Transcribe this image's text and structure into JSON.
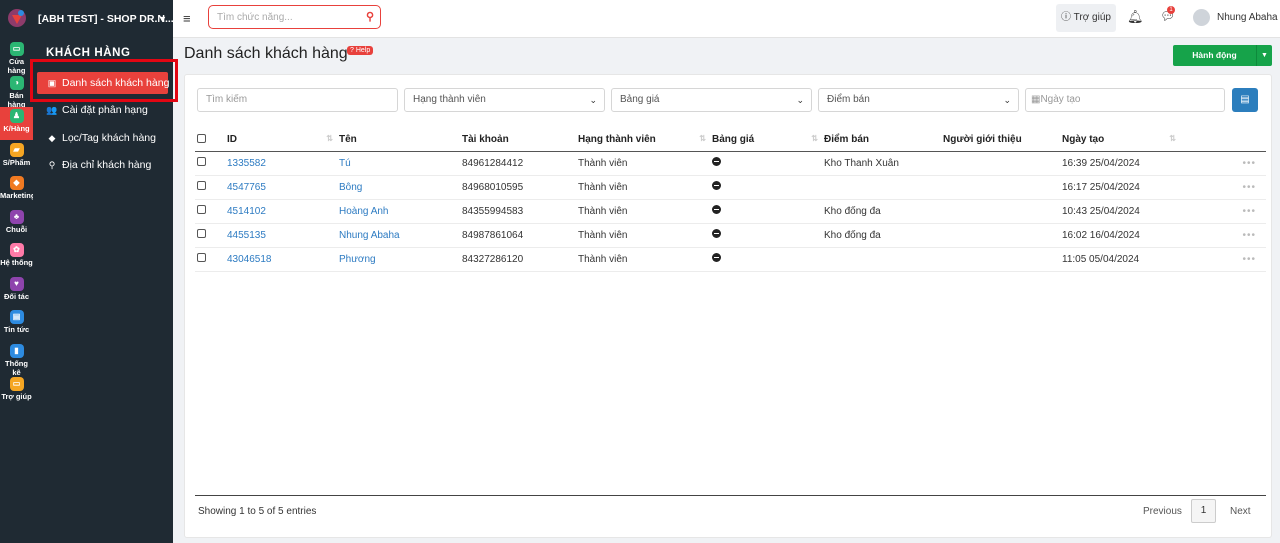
{
  "app": {
    "shop_name": "[ABH TEST] - SHOP DR.N..."
  },
  "rail": [
    {
      "label": "Cửa hàng",
      "icon": "store-icon",
      "color": "#2bb673"
    },
    {
      "label": "Bán hàng",
      "icon": "sales-icon",
      "color": "#2bb673"
    },
    {
      "label": "K/Hàng",
      "icon": "customer-icon",
      "color": "#2bb673"
    },
    {
      "label": "S/Phẩm",
      "icon": "product-icon",
      "color": "#f5a623"
    },
    {
      "label": "Marketing",
      "icon": "marketing-icon",
      "color": "#f07a22"
    },
    {
      "label": "Chuỗi",
      "icon": "chain-icon",
      "color": "#8e44ad"
    },
    {
      "label": "Hệ thống",
      "icon": "system-icon",
      "color": "#ff7aa8"
    },
    {
      "label": "Đối tác",
      "icon": "partner-icon",
      "color": "#8e44ad"
    },
    {
      "label": "Tin tức",
      "icon": "news-icon",
      "color": "#2d8be0"
    },
    {
      "label": "Thống kê",
      "icon": "stats-icon",
      "color": "#2d8be0"
    },
    {
      "label": "Trợ giúp",
      "icon": "help-icon",
      "color": "#f5a623"
    }
  ],
  "subnav": {
    "title": "KHÁCH HÀNG",
    "items": [
      {
        "label": "Danh sách khách hàng",
        "icon": "address-card-icon"
      },
      {
        "label": "Cài đặt phân hạng",
        "icon": "users-icon"
      },
      {
        "label": "Lọc/Tag khách hàng",
        "icon": "tag-icon"
      },
      {
        "label": "Địa chỉ khách hàng",
        "icon": "map-pin-icon"
      }
    ]
  },
  "topbar": {
    "search_placeholder": "Tìm chức năng...",
    "help_label": "Trợ giúp",
    "chat_badge": "1",
    "user_name": "Nhung Abaha"
  },
  "page": {
    "title": "Danh sách khách hàng",
    "help_badge": "Help",
    "action_label": "Hành động"
  },
  "filters": {
    "search_placeholder": "Tìm kiếm",
    "tier": "Hạng thành viên",
    "price": "Bảng giá",
    "store": "Điểm bán",
    "created": "Ngày tạo"
  },
  "table": {
    "headers": [
      "ID",
      "Tên",
      "Tài khoản",
      "Hạng thành viên",
      "Bảng giá",
      "Điểm bán",
      "Người giới thiệu",
      "Ngày tạo"
    ],
    "rows": [
      {
        "id": "1335582",
        "name": "Tú",
        "account": "84961284412",
        "tier": "Thành viên",
        "store": "Kho Thanh Xuân",
        "referrer": "",
        "created": "16:39 25/04/2024"
      },
      {
        "id": "4547765",
        "name": "Bông",
        "account": "84968010595",
        "tier": "Thành viên",
        "store": "",
        "referrer": "",
        "created": "16:17 25/04/2024"
      },
      {
        "id": "4514102",
        "name": "Hoàng Anh",
        "account": "84355994583",
        "tier": "Thành viên",
        "store": "Kho đống đa",
        "referrer": "",
        "created": "10:43 25/04/2024"
      },
      {
        "id": "4455135",
        "name": "Nhung Abaha",
        "account": "84987861064",
        "tier": "Thành viên",
        "store": "Kho đống đa",
        "referrer": "",
        "created": "16:02 16/04/2024"
      },
      {
        "id": "43046518",
        "name": "Phương",
        "account": "84327286120",
        "tier": "Thành viên",
        "store": "",
        "referrer": "",
        "created": "11:05 05/04/2024"
      }
    ]
  },
  "footer": {
    "showing": "Showing 1 to 5 of 5 entries",
    "previous": "Previous",
    "page": "1",
    "next": "Next"
  },
  "colors": {
    "accent": "#e8413c",
    "action": "#16a34a",
    "link": "#2d7bc2",
    "sidebar": "#1f2a33"
  }
}
